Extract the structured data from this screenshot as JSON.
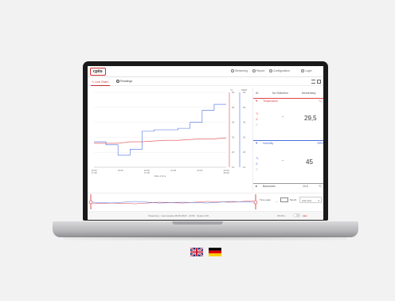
{
  "app": {
    "logo": "cpits",
    "nav": [
      "Streaming",
      "Report",
      "Configuration",
      "Login"
    ]
  },
  "tabs": [
    {
      "label": "Live Chart",
      "active": true
    },
    {
      "label": "Readings",
      "active": false
    }
  ],
  "chart": {
    "left_axis": {
      "header": "°C",
      "ticks": [
        "60",
        "50",
        "40",
        "30",
        "20",
        "10"
      ]
    },
    "right_axis": {
      "header": "%RH",
      "ticks": [
        "60",
        "50",
        "40",
        "30",
        "20",
        "10"
      ]
    },
    "x_ticks": [
      "16:59",
      "19:00",
      "20:00",
      "21:00",
      "22:00",
      "23:59"
    ],
    "x_sub": [
      "17.08",
      "",
      "27.08",
      "",
      "",
      "28.08"
    ],
    "x_label": "Date & time",
    "colors": {
      "humidity": "#4a6fdc",
      "temperature": "#e0474c"
    }
  },
  "chart_data": {
    "type": "line",
    "series": [
      {
        "name": "Temperature",
        "values": [
          26,
          26,
          26,
          27,
          27,
          27.5,
          28,
          28,
          28.5,
          29,
          29,
          29.5
        ]
      },
      {
        "name": "Humidity",
        "values": [
          27,
          25,
          18,
          22,
          34,
          35,
          35,
          36,
          40,
          48,
          52,
          52
        ]
      }
    ]
  },
  "panel": {
    "col1": "ID",
    "col2": "No Selection",
    "col3": "Momentary",
    "temp": {
      "title": "Temperature",
      "unit": "°C",
      "dash": "-",
      "value": "29,5",
      "color": "#e0474c"
    },
    "hum": {
      "title": "Humidity",
      "unit": "%RH",
      "dash": "-",
      "value": "45",
      "color": "#4a6fdc"
    },
    "bottom": {
      "title": "Barometer",
      "value": "10.5",
      "unit": "°C"
    }
  },
  "range": {
    "label": "Time span",
    "unit": "Month",
    "select": "Auto (1h)"
  },
  "status": {
    "text": "Streaming · Last sample 28.08.2023 · 23:59 · System OK",
    "right": "25.08.1"
  },
  "languages": [
    "English",
    "Deutsch"
  ]
}
